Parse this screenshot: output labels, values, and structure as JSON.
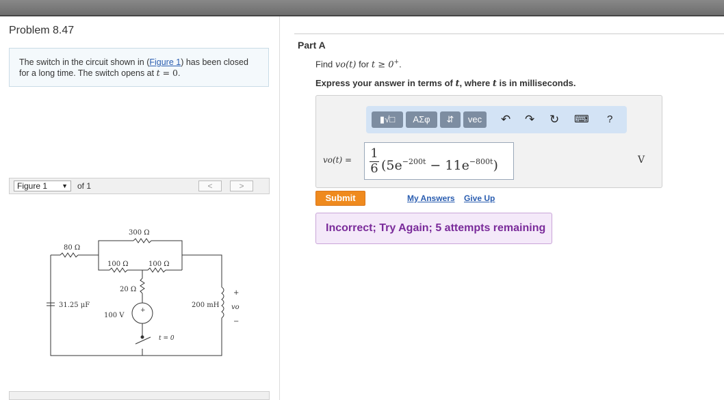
{
  "problem": {
    "title": "Problem 8.47",
    "text_before": "The switch in the circuit shown in (",
    "figure_link": "Figure 1",
    "text_mid": ") has been closed for a long time. The switch opens at ",
    "t_var": "t",
    "equals_zero": " = 0",
    "text_end": "."
  },
  "figure_nav": {
    "selected": "Figure 1",
    "of_label": "of 1",
    "prev": "<",
    "next": ">"
  },
  "circuit": {
    "r80": "80 Ω",
    "r300": "300 Ω",
    "r100a": "100 Ω",
    "r100b": "100 Ω",
    "r20": "20 Ω",
    "cap": "31.25 μF",
    "src": "100 V",
    "ind": "200 mH",
    "switch": "t = 0",
    "plus": "+",
    "minus": "−",
    "src_plus": "+",
    "vo": "vo"
  },
  "part": {
    "title": "Part A",
    "find_prefix": "Find ",
    "find_vo": "vo(t)",
    "find_mid": " for ",
    "find_cond": "t ≥ 0",
    "find_sup": "+",
    "find_end": ".",
    "express_prefix": "Express your answer in terms of ",
    "express_t1": "t",
    "express_mid": ", where ",
    "express_t2": "t",
    "express_end": " is in milliseconds."
  },
  "toolbar": {
    "templates": "▮√□",
    "greek": "ΑΣφ",
    "arrows": "⇵",
    "vec": "vec",
    "help": "?"
  },
  "answer": {
    "label": "vo(t) =",
    "frac_num": "1",
    "frac_den": "6",
    "open": "(5e",
    "exp1": "−200t",
    "mid": " − 11e",
    "exp2": "−800t",
    "close": ")",
    "unit": "V"
  },
  "actions": {
    "submit": "Submit",
    "my_answers": "My Answers",
    "give_up": "Give Up"
  },
  "feedback": "Incorrect; Try Again; 5 attempts remaining"
}
